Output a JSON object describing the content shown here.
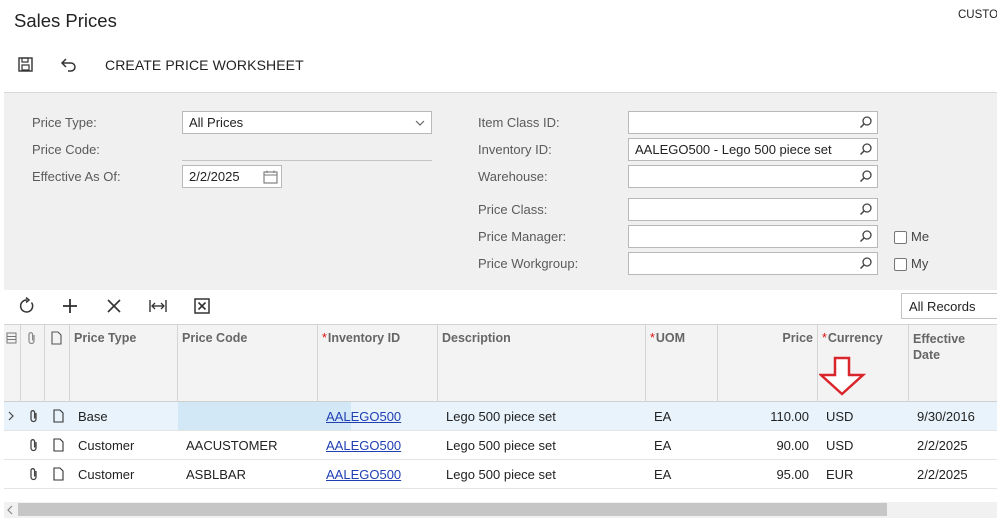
{
  "header": {
    "title": "Sales Prices",
    "right_text": "CUSTO"
  },
  "toolbar": {
    "save_icon": "save-icon",
    "undo_icon": "undo-icon",
    "create_worksheet_label": "CREATE PRICE WORKSHEET"
  },
  "form": {
    "price_type": {
      "label": "Price Type:",
      "value": "All Prices"
    },
    "price_code": {
      "label": "Price Code:",
      "value": ""
    },
    "effective_as_of": {
      "label": "Effective As Of:",
      "value": "2/2/2025"
    },
    "item_class_id": {
      "label": "Item Class ID:",
      "value": ""
    },
    "inventory_id": {
      "label": "Inventory ID:",
      "value": "AALEGO500 - Lego 500 piece set"
    },
    "warehouse": {
      "label": "Warehouse:",
      "value": ""
    },
    "price_class": {
      "label": "Price Class:",
      "value": ""
    },
    "price_manager": {
      "label": "Price Manager:",
      "value": "",
      "checkbox_label": "Me",
      "checked": false
    },
    "price_workgroup": {
      "label": "Price Workgroup:",
      "value": "",
      "checkbox_label": "My",
      "checked": false
    }
  },
  "grid_toolbar": {
    "icons": [
      "refresh-icon",
      "add-icon",
      "delete-icon",
      "fit-columns-icon",
      "export-excel-icon"
    ],
    "records_filter": "All Records"
  },
  "grid": {
    "columns": {
      "price_type": "Price Type",
      "price_code": "Price Code",
      "inventory_id": "Inventory ID",
      "description": "Description",
      "uom": "UOM",
      "price": "Price",
      "currency": "Currency",
      "effective_date_1": "Effective",
      "effective_date_2": "Date"
    },
    "rows": [
      {
        "price_type": "Base",
        "price_code": "",
        "inventory_id": "AALEGO500",
        "description": "Lego 500 piece set",
        "uom": "EA",
        "price": "110.00",
        "currency": "USD",
        "effective_date": "9/30/2016"
      },
      {
        "price_type": "Customer",
        "price_code": "AACUSTOMER",
        "inventory_id": "AALEGO500",
        "description": "Lego 500 piece set",
        "uom": "EA",
        "price": "90.00",
        "currency": "USD",
        "effective_date": "2/2/2025"
      },
      {
        "price_type": "Customer",
        "price_code": "ASBLBAR",
        "inventory_id": "AALEGO500",
        "description": "Lego 500 piece set",
        "uom": "EA",
        "price": "95.00",
        "currency": "EUR",
        "effective_date": "2/2/2025"
      }
    ]
  },
  "annotation": {
    "arrow_color": "#d9262c",
    "points_to": "Currency"
  }
}
